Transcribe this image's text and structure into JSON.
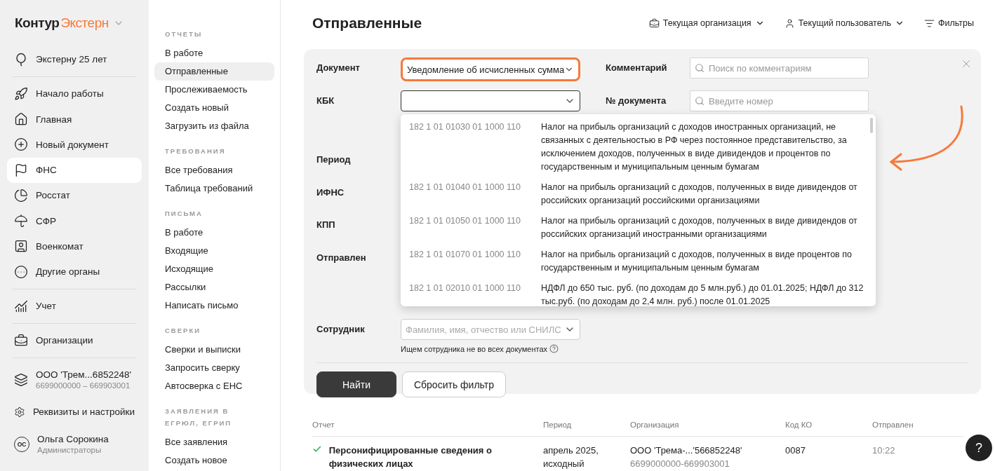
{
  "logo": {
    "part_1": "Контур",
    "part_2": "Экстерн"
  },
  "sidebar": {
    "promo": "Экстерну 25 лет",
    "groups": [
      [
        {
          "label": "Начало работы",
          "selected": false
        },
        {
          "label": "Главная",
          "selected": false
        },
        {
          "label": "Новый документ",
          "selected": false
        },
        {
          "label": "ФНС",
          "selected": true
        },
        {
          "label": "Росстат",
          "selected": false
        },
        {
          "label": "СФР",
          "selected": false
        },
        {
          "label": "Военкомат",
          "selected": false
        },
        {
          "label": "Другие органы",
          "selected": false
        }
      ],
      [
        {
          "label": "Учет",
          "selected": false
        }
      ],
      [
        {
          "label": "Организации",
          "selected": false
        }
      ]
    ],
    "org": {
      "name": "ООО 'Трем...6852248'",
      "codes": "6699000000 – 669903001"
    },
    "settings": "Реквизиты и настройки",
    "user": {
      "initials": "ОС",
      "name": "Ольга Сорокина",
      "role": "Администраторы"
    }
  },
  "subnav": [
    {
      "title": "ОТЧЕТЫ",
      "items": [
        {
          "label": "В работе",
          "selected": false
        },
        {
          "label": "Отправленные",
          "selected": true
        },
        {
          "label": "Прослеживаемость",
          "selected": false
        },
        {
          "label": "Создать новый",
          "selected": false
        },
        {
          "label": "Загрузить из файла",
          "selected": false
        }
      ]
    },
    {
      "title": "ТРЕБОВАНИЯ",
      "items": [
        {
          "label": "Все требования",
          "selected": false
        },
        {
          "label": "Таблица требований",
          "selected": false
        }
      ]
    },
    {
      "title": "ПИСЬМА",
      "items": [
        {
          "label": "В работе",
          "selected": false
        },
        {
          "label": "Входящие",
          "selected": false
        },
        {
          "label": "Исходящие",
          "selected": false
        },
        {
          "label": "Рассылки",
          "selected": false
        },
        {
          "label": "Написать письмо",
          "selected": false
        }
      ]
    },
    {
      "title": "СВЕРКИ",
      "items": [
        {
          "label": "Сверки и выписки",
          "selected": false
        },
        {
          "label": "Запросить сверку",
          "selected": false
        },
        {
          "label": "Автосверка с ЕНС",
          "selected": false
        }
      ]
    },
    {
      "title": "ЗАЯВЛЕНИЯ В ЕГРЮЛ, ЕГРИП",
      "items": [
        {
          "label": "Все заявления",
          "selected": false
        },
        {
          "label": "Создать новое",
          "selected": false
        }
      ]
    }
  ],
  "page": {
    "title": "Отправленные",
    "actions": [
      {
        "label": "Текущая организация",
        "caret": true
      },
      {
        "label": "Текущий пользователь",
        "caret": true
      },
      {
        "label": "Фильтры",
        "caret": false
      }
    ]
  },
  "filters": {
    "left": [
      {
        "label": "Документ",
        "kind": "select",
        "value": "Уведомление об исчисленных сумма",
        "highlighted": true
      },
      {
        "label": "КБК",
        "kind": "select",
        "focused": true
      },
      {
        "label": "Период",
        "kind": "covered"
      },
      {
        "label": "ИФНС",
        "kind": "covered"
      },
      {
        "label": "КПП",
        "kind": "covered"
      },
      {
        "label": "Отправлен",
        "kind": "covered"
      },
      {
        "label": "Сотрудник",
        "kind": "select",
        "placeholder": "Фамилия, имя, отчество или СНИЛС",
        "hint": "Ищем сотрудника не во всех документах"
      }
    ],
    "right": [
      {
        "label": "Комментарий",
        "placeholder": "Поиск по комментариям"
      },
      {
        "label": "№ документа",
        "placeholder": "Введите номер"
      }
    ],
    "kbk_options": [
      {
        "code": "182 1 01 01030 01 1000 110",
        "text": "Налог на прибыль организаций с доходов иностранных организаций, не связанных с деятельностью в РФ через постоянное представительство, за исключением доходов, полученных в виде дивидендов и процентов по государственным и муниципальным ценным бумагам"
      },
      {
        "code": "182 1 01 01040 01 1000 110",
        "text": "Налог на прибыль организаций с доходов, полученных в виде дивидендов от российских организаций российскими организациями"
      },
      {
        "code": "182 1 01 01050 01 1000 110",
        "text": "Налог на прибыль организаций с доходов, полученных в виде дивидендов от российских организаций иностранными организациями"
      },
      {
        "code": "182 1 01 01070 01 1000 110",
        "text": "Налог на прибыль организаций с доходов, полученных в виде процентов по государственным и муниципальным ценным бумагам"
      },
      {
        "code": "182 1 01 02010 01 1000 110",
        "text": "НДФЛ до 650 тыс. руб. (по доходам до 5 млн.руб.) до 01.01.2025; НДФЛ до 312 тыс.руб. (по доходам до 2,4 млн. руб.) после 01.01.2025"
      }
    ],
    "buttons": {
      "find": "Найти",
      "reset": "Сбросить фильтр"
    }
  },
  "table": {
    "columns": [
      "Отчет",
      "Период",
      "Организация",
      "Код КО",
      "Отправлен"
    ],
    "rows": [
      {
        "done": true,
        "report": "Персонифицированные сведения о физических лицах",
        "period": [
          "апрель 2025,",
          "исходный"
        ],
        "org": "ООО 'Трема-...'566852248'",
        "org_codes": "6699000000-669903001",
        "code": "0087",
        "sent": "10:22"
      }
    ]
  },
  "help": "?"
}
